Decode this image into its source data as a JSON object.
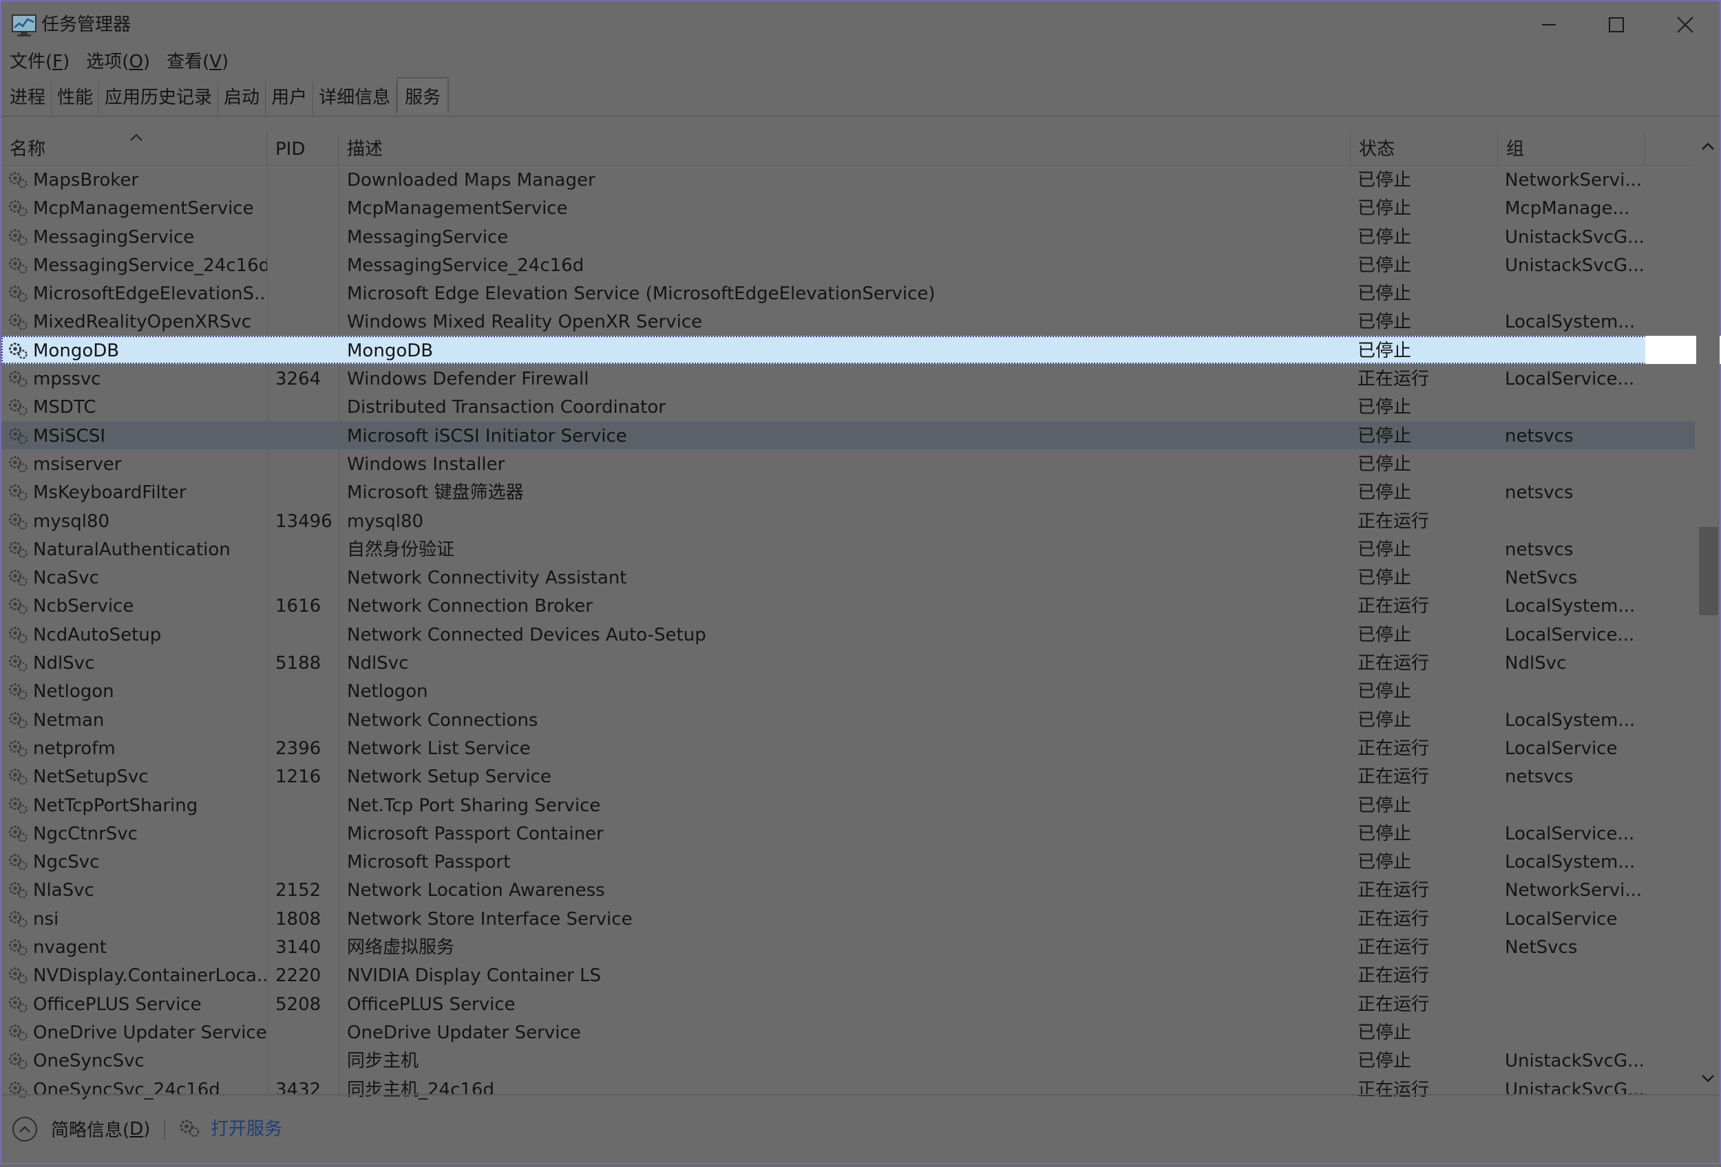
{
  "window": {
    "title": "任务管理器"
  },
  "menu": [
    {
      "label": "文件(",
      "acc": "F",
      "end": ")"
    },
    {
      "label": "选项(",
      "acc": "O",
      "end": ")"
    },
    {
      "label": "查看(",
      "acc": "V",
      "end": ")"
    }
  ],
  "tabs": [
    "进程",
    "性能",
    "应用历史记录",
    "启动",
    "用户",
    "详细信息",
    "服务"
  ],
  "active_tab": "服务",
  "columns": {
    "name": "名称",
    "pid": "PID",
    "desc": "描述",
    "status": "状态",
    "group": "组"
  },
  "rows": [
    {
      "name": "MapsBroker",
      "pid": "",
      "desc": "Downloaded Maps Manager",
      "status": "已停止",
      "group": "NetworkServi..."
    },
    {
      "name": "McpManagementService",
      "pid": "",
      "desc": "McpManagementService",
      "status": "已停止",
      "group": "McpManage..."
    },
    {
      "name": "MessagingService",
      "pid": "",
      "desc": "MessagingService",
      "status": "已停止",
      "group": "UnistackSvcG..."
    },
    {
      "name": "MessagingService_24c16d",
      "pid": "",
      "desc": "MessagingService_24c16d",
      "status": "已停止",
      "group": "UnistackSvcG..."
    },
    {
      "name": "MicrosoftEdgeElevationS...",
      "pid": "",
      "desc": "Microsoft Edge Elevation Service (MicrosoftEdgeElevationService)",
      "status": "已停止",
      "group": ""
    },
    {
      "name": "MixedRealityOpenXRSvc",
      "pid": "",
      "desc": "Windows Mixed Reality OpenXR Service",
      "status": "已停止",
      "group": "LocalSystem..."
    },
    {
      "name": "MongoDB",
      "pid": "",
      "desc": "MongoDB",
      "status": "已停止",
      "group": "",
      "selected": true
    },
    {
      "name": "mpssvc",
      "pid": "3264",
      "desc": "Windows Defender Firewall",
      "status": "正在运行",
      "group": "LocalService..."
    },
    {
      "name": "MSDTC",
      "pid": "",
      "desc": "Distributed Transaction Coordinator",
      "status": "已停止",
      "group": ""
    },
    {
      "name": "MSiSCSI",
      "pid": "",
      "desc": "Microsoft iSCSI Initiator Service",
      "status": "已停止",
      "group": "netsvcs",
      "hover": true
    },
    {
      "name": "msiserver",
      "pid": "",
      "desc": "Windows Installer",
      "status": "已停止",
      "group": ""
    },
    {
      "name": "MsKeyboardFilter",
      "pid": "",
      "desc": "Microsoft 键盘筛选器",
      "status": "已停止",
      "group": "netsvcs"
    },
    {
      "name": "mysql80",
      "pid": "13496",
      "desc": "mysql80",
      "status": "正在运行",
      "group": ""
    },
    {
      "name": "NaturalAuthentication",
      "pid": "",
      "desc": "自然身份验证",
      "status": "已停止",
      "group": "netsvcs"
    },
    {
      "name": "NcaSvc",
      "pid": "",
      "desc": "Network Connectivity Assistant",
      "status": "已停止",
      "group": "NetSvcs"
    },
    {
      "name": "NcbService",
      "pid": "1616",
      "desc": "Network Connection Broker",
      "status": "正在运行",
      "group": "LocalSystem..."
    },
    {
      "name": "NcdAutoSetup",
      "pid": "",
      "desc": "Network Connected Devices Auto-Setup",
      "status": "已停止",
      "group": "LocalService..."
    },
    {
      "name": "NdlSvc",
      "pid": "5188",
      "desc": "NdlSvc",
      "status": "正在运行",
      "group": "NdlSvc"
    },
    {
      "name": "Netlogon",
      "pid": "",
      "desc": "Netlogon",
      "status": "已停止",
      "group": ""
    },
    {
      "name": "Netman",
      "pid": "",
      "desc": "Network Connections",
      "status": "已停止",
      "group": "LocalSystem..."
    },
    {
      "name": "netprofm",
      "pid": "2396",
      "desc": "Network List Service",
      "status": "正在运行",
      "group": "LocalService"
    },
    {
      "name": "NetSetupSvc",
      "pid": "1216",
      "desc": "Network Setup Service",
      "status": "正在运行",
      "group": "netsvcs"
    },
    {
      "name": "NetTcpPortSharing",
      "pid": "",
      "desc": "Net.Tcp Port Sharing Service",
      "status": "已停止",
      "group": ""
    },
    {
      "name": "NgcCtnrSvc",
      "pid": "",
      "desc": "Microsoft Passport Container",
      "status": "已停止",
      "group": "LocalService..."
    },
    {
      "name": "NgcSvc",
      "pid": "",
      "desc": "Microsoft Passport",
      "status": "已停止",
      "group": "LocalSystem..."
    },
    {
      "name": "NlaSvc",
      "pid": "2152",
      "desc": "Network Location Awareness",
      "status": "正在运行",
      "group": "NetworkServi..."
    },
    {
      "name": "nsi",
      "pid": "1808",
      "desc": "Network Store Interface Service",
      "status": "正在运行",
      "group": "LocalService"
    },
    {
      "name": "nvagent",
      "pid": "3140",
      "desc": "网络虚拟服务",
      "status": "正在运行",
      "group": "NetSvcs"
    },
    {
      "name": "NVDisplay.ContainerLoca...",
      "pid": "2220",
      "desc": "NVIDIA Display Container LS",
      "status": "正在运行",
      "group": ""
    },
    {
      "name": "OfficePLUS Service",
      "pid": "5208",
      "desc": "OfficePLUS Service",
      "status": "正在运行",
      "group": ""
    },
    {
      "name": "OneDrive Updater Service",
      "pid": "",
      "desc": "OneDrive Updater Service",
      "status": "已停止",
      "group": ""
    },
    {
      "name": "OneSyncSvc",
      "pid": "",
      "desc": "同步主机",
      "status": "已停止",
      "group": "UnistackSvcG..."
    },
    {
      "name": "OneSyncSvc_24c16d",
      "pid": "3432",
      "desc": "同步主机_24c16d",
      "status": "正在运行",
      "group": "UnistackSvcG..."
    }
  ],
  "footer": {
    "brief_label": "简略信息(",
    "brief_acc": "D",
    "brief_end": ")",
    "open_services": "打开服务"
  },
  "colors": {
    "background": "#6b6b6b",
    "selected_row": "#cde6f7",
    "link": "#1d3f7a"
  },
  "icons": [
    "task-manager-icon",
    "minimize-icon",
    "maximize-icon",
    "close-icon",
    "sort-up-icon",
    "gear-service-icon",
    "scroll-up-icon",
    "scroll-down-icon",
    "chevron-up-icon"
  ]
}
